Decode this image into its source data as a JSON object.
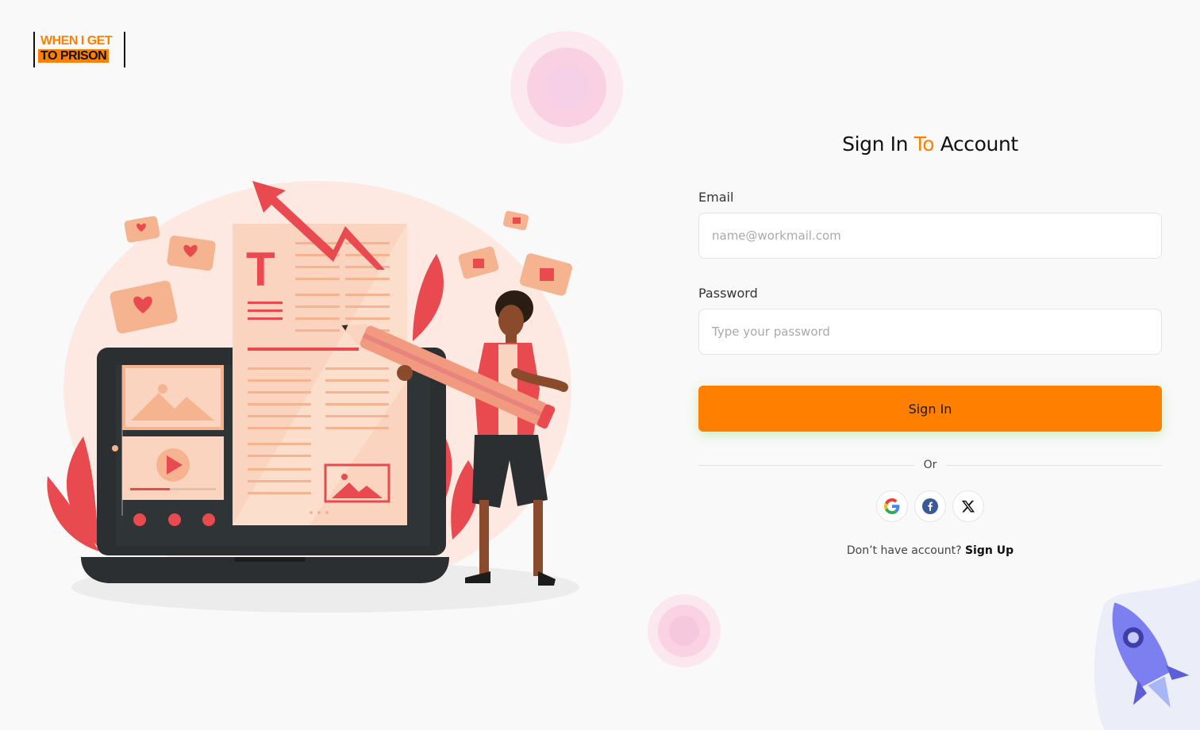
{
  "brand": {
    "line1": "WHEN I GET",
    "line2": "TO PRISON",
    "accent_color": "#ff7f00"
  },
  "form": {
    "title_part1": "Sign In",
    "title_accent": "To",
    "title_part2": "Account",
    "email_label": "Email",
    "email_placeholder": "name@workmail.com",
    "password_label": "Password",
    "password_placeholder": "Type your password",
    "submit_label": "Sign In",
    "divider_text": "Or",
    "social": [
      {
        "name": "google-icon"
      },
      {
        "name": "facebook-icon"
      },
      {
        "name": "x-icon"
      }
    ],
    "signup_prompt": "Don’t have account?",
    "signup_link": "Sign Up"
  },
  "colors": {
    "primary": "#ff7f00",
    "background": "#f9f9f9",
    "illustration_red": "#e84a4f",
    "illustration_peach": "#fbd4bf"
  }
}
